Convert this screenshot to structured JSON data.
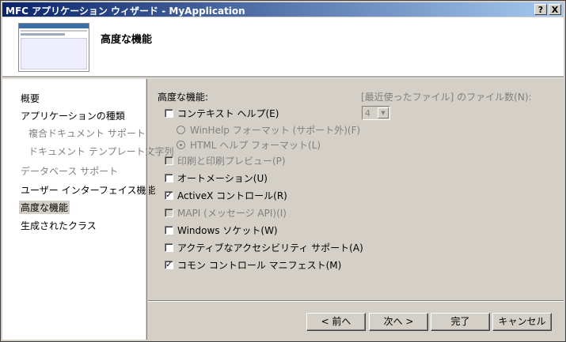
{
  "window": {
    "title": "MFC アプリケーション ウィザード - MyApplication",
    "help_button": "?",
    "close_button": "X"
  },
  "header": {
    "title": "高度な機能"
  },
  "nav": {
    "items": [
      {
        "label": "概要",
        "state": "normal"
      },
      {
        "label": "アプリケーションの種類",
        "state": "normal"
      },
      {
        "label": "複合ドキュメント サポート",
        "state": "disabled"
      },
      {
        "label": "ドキュメント テンプレート文字列",
        "state": "disabled"
      },
      {
        "label": "データベース サポート",
        "state": "disabled"
      },
      {
        "label": "ユーザー インターフェイス機能",
        "state": "normal"
      },
      {
        "label": "高度な機能",
        "state": "selected"
      },
      {
        "label": "生成されたクラス",
        "state": "normal"
      }
    ]
  },
  "content": {
    "section_label": "高度な機能:",
    "options": [
      {
        "label": "コンテキスト ヘルプ(E)",
        "checked": false,
        "enabled": true
      },
      {
        "label": "印刷と印刷プレビュー(P)",
        "checked": false,
        "enabled": false
      },
      {
        "label": "オートメーション(U)",
        "checked": false,
        "enabled": true
      },
      {
        "label": "ActiveX コントロール(R)",
        "checked": true,
        "enabled": true
      },
      {
        "label": "MAPI (メッセージ API)(I)",
        "checked": false,
        "enabled": false
      },
      {
        "label": "Windows ソケット(W)",
        "checked": false,
        "enabled": true
      },
      {
        "label": "アクティブなアクセシビリティ サポート(A)",
        "checked": false,
        "enabled": true
      },
      {
        "label": "コモン コントロール マニフェスト(M)",
        "checked": true,
        "enabled": true
      }
    ],
    "help_formats": [
      {
        "label": "WinHelp フォーマット (サポート外)(F)",
        "selected": false
      },
      {
        "label": "HTML ヘルプ フォーマット(L)",
        "selected": true
      }
    ],
    "mru_label": "[最近使ったファイル] のファイル数(N):",
    "mru_value": "4"
  },
  "buttons": {
    "back": "< 前へ",
    "next": "次へ >",
    "finish": "完了",
    "cancel": "キャンセル"
  }
}
